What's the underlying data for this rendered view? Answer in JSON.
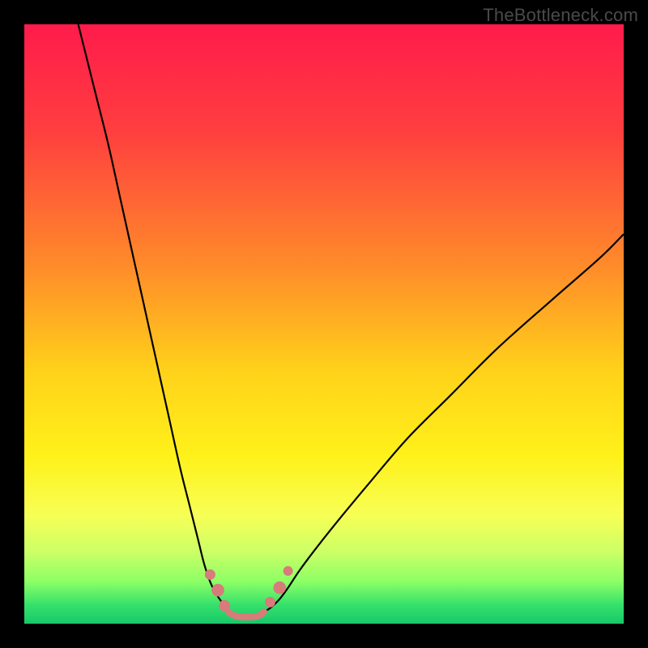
{
  "watermark": "TheBottleneck.com",
  "chart_data": {
    "type": "line",
    "title": "",
    "xlabel": "",
    "ylabel": "",
    "xlim": [
      0,
      100
    ],
    "ylim": [
      0,
      100
    ],
    "background_gradient_stops": [
      {
        "offset": 0,
        "color": "#ff1b4b"
      },
      {
        "offset": 18,
        "color": "#ff3f3f"
      },
      {
        "offset": 40,
        "color": "#ff8a2a"
      },
      {
        "offset": 58,
        "color": "#ffd21a"
      },
      {
        "offset": 72,
        "color": "#fff11a"
      },
      {
        "offset": 82,
        "color": "#f7ff56"
      },
      {
        "offset": 88,
        "color": "#ccff66"
      },
      {
        "offset": 93,
        "color": "#8cff66"
      },
      {
        "offset": 97,
        "color": "#33e06b"
      },
      {
        "offset": 100,
        "color": "#19c76a"
      }
    ],
    "series": [
      {
        "name": "left-branch",
        "stroke": "#000000",
        "stroke_width": 2.2,
        "x": [
          9,
          10,
          12,
          14,
          16,
          18,
          20,
          22,
          24,
          26,
          27.5,
          29,
          30,
          31,
          32,
          33,
          33.5,
          34
        ],
        "y": [
          100,
          96,
          88,
          80,
          71,
          62,
          53,
          44,
          35,
          26,
          20,
          14,
          10,
          7,
          5,
          3.5,
          2.5,
          2
        ]
      },
      {
        "name": "right-branch",
        "stroke": "#000000",
        "stroke_width": 2.2,
        "x": [
          40,
          41,
          42.5,
          44,
          46,
          49,
          53,
          58,
          64,
          71,
          79,
          88,
          96,
          100
        ],
        "y": [
          2,
          2.6,
          4,
          6,
          9,
          13,
          18,
          24,
          31,
          38,
          46,
          54,
          61,
          65
        ]
      },
      {
        "name": "valley-connector",
        "stroke": "#d77b7b",
        "stroke_width": 8,
        "linecap": "round",
        "x": [
          34,
          35.2,
          37,
          39,
          40
        ],
        "y": [
          2,
          1.3,
          1.1,
          1.3,
          2
        ]
      }
    ],
    "markers": [
      {
        "name": "left-bead-1",
        "x": 31.0,
        "y": 8.2,
        "r": 6.5,
        "color": "#d77b7b"
      },
      {
        "name": "left-bead-2",
        "x": 32.3,
        "y": 5.6,
        "r": 7.8,
        "color": "#d77b7b"
      },
      {
        "name": "left-bead-3",
        "x": 33.4,
        "y": 3.0,
        "r": 7.0,
        "color": "#d77b7b"
      },
      {
        "name": "right-bead-1",
        "x": 41.0,
        "y": 3.6,
        "r": 6.5,
        "color": "#d77b7b"
      },
      {
        "name": "right-bead-2",
        "x": 42.6,
        "y": 6.0,
        "r": 7.8,
        "color": "#d77b7b"
      },
      {
        "name": "right-bead-3",
        "x": 44.0,
        "y": 8.8,
        "r": 6.0,
        "color": "#d77b7b"
      }
    ]
  }
}
